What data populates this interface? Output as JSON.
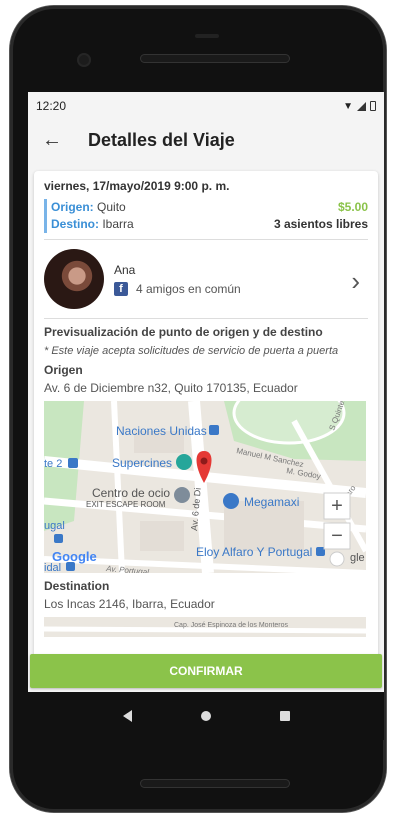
{
  "status": {
    "time": "12:20"
  },
  "appbar": {
    "title": "Detalles del Viaje"
  },
  "trip": {
    "datetime": "viernes, 17/mayo/2019   9:00 p. m.",
    "origin_label": "Origen:",
    "origin_value": "Quito",
    "destination_label": "Destino:",
    "destination_value": "Ibarra",
    "price": "$5.00",
    "seats": "3 asientos libres"
  },
  "driver": {
    "name": "Ana",
    "mutual_friends": "4 amigos en común"
  },
  "preview": {
    "title": "Previsualización de punto de origen y de destino",
    "note": "* Este viaje acepta solicitudes de servicio de puerta a puerta"
  },
  "origin_section": {
    "title": "Origen",
    "address": "Av. 6 de Diciembre n32, Quito 170135, Ecuador"
  },
  "map1": {
    "labels": {
      "naciones": "Naciones Unidas",
      "manuel": "Manuel M Sanchez",
      "godoy": "M. Godoy",
      "supercines": "Supercines",
      "centro": "Centro de ocio",
      "exit": "EXIT ESCAPE ROOM",
      "megamaxi": "Megamaxi",
      "eloy": "Eloy Alfaro Y Portugal",
      "portugal": "Av. Portugal",
      "av6": "Av. 6 de Di",
      "quintero": "S Quintero",
      "te2": "te 2",
      "ugal": "ugal",
      "idal": "idal",
      "gle": "gle",
      "alfaro": "Eloy Alfaro",
      "google": "Google"
    }
  },
  "destination_section": {
    "title": "Destination",
    "address": "Los Incas 2146, Ibarra, Ecuador"
  },
  "map2": {
    "label": "Cap. José Espinoza de los Monteros"
  },
  "confirm_label": "CONFIRMAR",
  "colors": {
    "accent_green": "#8bc34a",
    "accent_blue": "#3a8fd6",
    "pin_red": "#e53935",
    "facebook": "#3b5998"
  }
}
